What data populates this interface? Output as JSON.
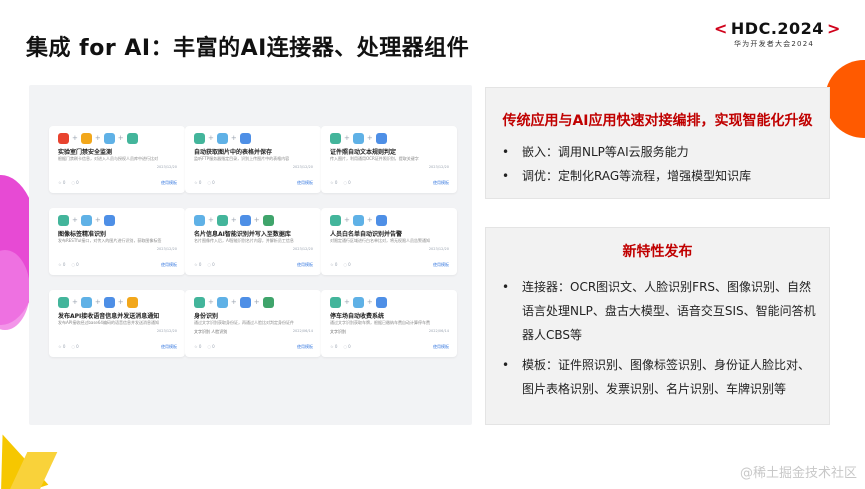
{
  "header": {
    "title": "集成 for AI：丰富的AI连接器、处理器组件",
    "brand_lt": "<",
    "brand_name": "HDC.2024",
    "brand_gt": ">",
    "brand_sub": "华为开发者大会2024"
  },
  "cards": [
    {
      "title": "实验室门禁安全监测",
      "desc": "根据门禁刷卡信息，对进入人员与授权人员库中进行比对",
      "date": "2023/12/20",
      "likes": "0",
      "comments": "0",
      "link": "使用模板",
      "tags": "",
      "icons": [
        "#e8432f",
        "#f2a71b",
        "#5fb1e6",
        "#43b59b"
      ]
    },
    {
      "title": "自动获取图片中的表格并保存",
      "desc": "监听FTP服务器指定目录，识别上传图片中的表格内容",
      "date": "2023/12/20",
      "likes": "0",
      "comments": "0",
      "link": "使用模板",
      "tags": "",
      "icons": [
        "#43b59b",
        "#5fb1e6",
        "#4e8fe6"
      ]
    },
    {
      "title": "证件照自动文本规则判定",
      "desc": "传入图片，利用通用OCR证件照识别，提取关键字",
      "date": "2023/12/20",
      "likes": "0",
      "comments": "0",
      "link": "使用模板",
      "tags": "",
      "icons": [
        "#43b59b",
        "#5fb1e6",
        "#4e8fe6"
      ]
    },
    {
      "title": "图像标签精准识别",
      "desc": "发布RESTful接口，对传入的图片进行识别，获取图像标签",
      "date": "2023/12/20",
      "likes": "0",
      "comments": "0",
      "link": "使用模板",
      "tags": "",
      "icons": [
        "#43b59b",
        "#5fb1e6",
        "#4e8fe6"
      ]
    },
    {
      "title": "名片信息AI智能识别并写入至数据库",
      "desc": "名片图像传入后，AI智能识别名片内容，并解析员工信息",
      "date": "2023/12/20",
      "likes": "0",
      "comments": "0",
      "link": "使用模板",
      "tags": "",
      "icons": [
        "#5fb1e6",
        "#43b59b",
        "#4e8fe6",
        "#3fa46b"
      ]
    },
    {
      "title": "人员白名单自动识别并告警",
      "desc": "对限定通行区域进行白名单比对，将无权限人员告警通知",
      "date": "2023/12/20",
      "likes": "0",
      "comments": "0",
      "link": "使用模板",
      "tags": "",
      "icons": [
        "#43b59b",
        "#5fb1e6",
        "#4e8fe6"
      ]
    },
    {
      "title": "发布API接收语音信息并发送消息通知",
      "desc": "发布API接收经过base64编码的语音信息并发送消息通知",
      "date": "2023/12/20",
      "likes": "0",
      "comments": "0",
      "link": "使用模板",
      "tags": "",
      "icons": [
        "#43b59b",
        "#5fb1e6",
        "#4e8fe6",
        "#f2a71b"
      ]
    },
    {
      "title": "身份识别",
      "desc": "通过文字识别获取身份证，再通过人脸比对判定身份证件",
      "date": "2022/06/14",
      "likes": "0",
      "comments": "0",
      "link": "使用模板",
      "tags": "文字识别  人脸识别",
      "icons": [
        "#43b59b",
        "#5fb1e6",
        "#4e8fe6",
        "#3fa46b"
      ]
    },
    {
      "title": "停车场自动收费系统",
      "desc": "通过文字识别获取车牌，根据已缴纳车费自动计算停车费",
      "date": "2022/06/14",
      "likes": "0",
      "comments": "0",
      "link": "使用模板",
      "tags": "文字识别",
      "icons": [
        "#43b59b",
        "#5fb1e6",
        "#4e8fe6"
      ]
    }
  ],
  "panel_top": {
    "title": "传统应用与AI应用快速对接编排，实现智能化升级",
    "items": [
      "嵌入：调用NLP等AI云服务能力",
      "调优：定制化RAG等流程，增强模型知识库"
    ]
  },
  "panel_bottom": {
    "title": "新特性发布",
    "items": [
      "连接器：OCR图识文、人脸识别FRS、图像识别、自然语言处理NLP、盘古大模型、语音交互SIS、智能问答机器人CBS等",
      "模板：证件照识别、图像标签识别、身份证人脸比对、图片表格识别、发票识别、名片识别、车牌识别等"
    ]
  },
  "watermark": "@稀土掘金技术社区",
  "colors": {
    "accent_red": "#c00000",
    "brand_red": "#d0021b",
    "orange": "#ff5a00",
    "pink": "#e53bd0",
    "yellow": "#f6c700"
  }
}
